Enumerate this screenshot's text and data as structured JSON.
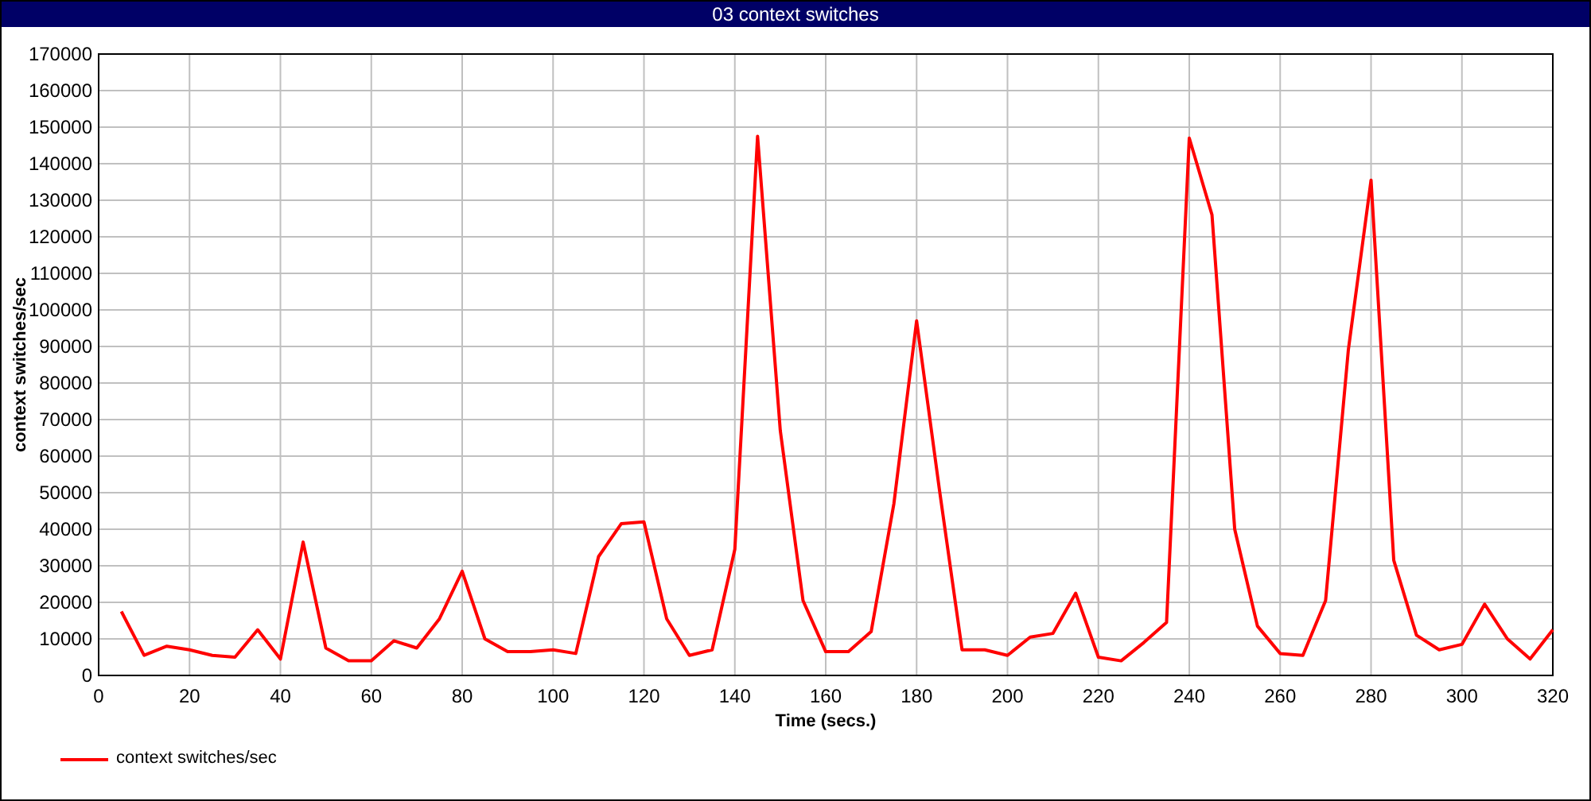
{
  "window": {
    "title": "03 context switches"
  },
  "chart": {
    "chart_data": {
      "type": "line",
      "grid": true,
      "xlabel": "Time (secs.)",
      "ylabel": "context switches/sec",
      "xlim": [
        0,
        320
      ],
      "ylim": [
        0,
        170000
      ],
      "xticks": [
        0,
        20,
        40,
        60,
        80,
        100,
        120,
        140,
        160,
        180,
        200,
        220,
        240,
        260,
        280,
        300,
        320
      ],
      "yticks": [
        0,
        10000,
        20000,
        30000,
        40000,
        50000,
        60000,
        70000,
        80000,
        90000,
        100000,
        110000,
        120000,
        130000,
        140000,
        150000,
        160000,
        170000
      ],
      "x": [
        5,
        10,
        15,
        20,
        25,
        30,
        35,
        40,
        45,
        50,
        55,
        60,
        65,
        70,
        75,
        80,
        85,
        90,
        95,
        100,
        105,
        110,
        115,
        120,
        125,
        130,
        135,
        140,
        145,
        150,
        155,
        160,
        165,
        170,
        175,
        180,
        185,
        190,
        195,
        200,
        205,
        210,
        215,
        220,
        225,
        230,
        235,
        240,
        245,
        250,
        255,
        260,
        265,
        270,
        275,
        280,
        285,
        290,
        295,
        300,
        305,
        310,
        315,
        320
      ],
      "series": [
        {
          "name": "context switches/sec",
          "color": "#ff0000",
          "values": [
            17500,
            5500,
            8000,
            7000,
            5500,
            5000,
            12500,
            4500,
            36500,
            7500,
            4000,
            4000,
            9500,
            7500,
            15500,
            28500,
            10000,
            6500,
            6500,
            7000,
            6000,
            32500,
            41500,
            42000,
            15500,
            5500,
            7000,
            34500,
            147500,
            67000,
            20500,
            6500,
            6500,
            12000,
            47000,
            97000,
            51000,
            7000,
            7000,
            5500,
            10500,
            11500,
            22500,
            5000,
            4000,
            9000,
            14500,
            147000,
            126000,
            40000,
            13500,
            6000,
            5500,
            20500,
            89000,
            135500,
            31500,
            11000,
            7000,
            8500,
            19500,
            10000,
            4500,
            12500
          ]
        }
      ]
    }
  }
}
